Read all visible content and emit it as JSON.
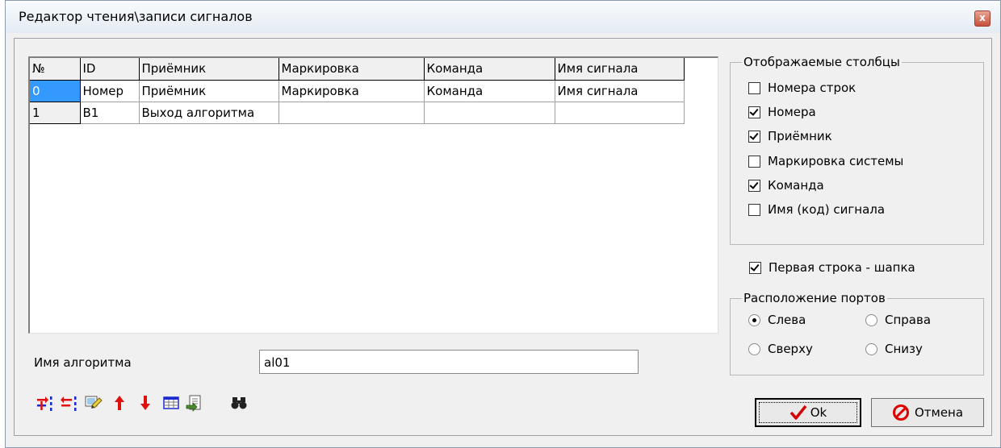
{
  "window": {
    "title": "Редактор чтения\\записи сигналов",
    "close_label": "x"
  },
  "grid": {
    "headers": [
      "№",
      "ID",
      "Приёмник",
      "Маркировка",
      "Команда",
      "Имя сигнала"
    ],
    "rows": [
      [
        "0",
        "Номер",
        "Приёмник",
        "Маркировка",
        "Команда",
        "Имя сигнала"
      ],
      [
        "1",
        "B1",
        "Выход алгоритма",
        "",
        "",
        ""
      ]
    ]
  },
  "columns_group": {
    "title": "Отображаемые столбцы",
    "items": [
      {
        "label": "Номера строк",
        "checked": false
      },
      {
        "label": "Номера",
        "checked": true
      },
      {
        "label": "Приёмник",
        "checked": true
      },
      {
        "label": "Маркировка системы",
        "checked": false
      },
      {
        "label": "Команда",
        "checked": true
      },
      {
        "label": "Имя (код) сигнала",
        "checked": false
      }
    ]
  },
  "header_row": {
    "label": "Первая строка - шапка",
    "checked": true
  },
  "ports_group": {
    "title": "Расположение портов",
    "options": [
      {
        "label": "Слева",
        "checked": true
      },
      {
        "label": "Справа",
        "checked": false
      },
      {
        "label": "Сверху",
        "checked": false
      },
      {
        "label": "Снизу",
        "checked": false
      }
    ]
  },
  "algorithm": {
    "label": "Имя алгоритма",
    "value": "al01"
  },
  "toolbar": [
    "add-row-icon",
    "delete-row-icon",
    "edit-icon",
    "move-up-icon",
    "move-down-icon",
    "table-icon",
    "import-icon",
    "find-icon"
  ],
  "buttons": {
    "ok": "Ok",
    "cancel": "Отмена"
  },
  "colors": {
    "selection": "#3399ff",
    "ok_check": "#d90000",
    "cancel_icon": "#e00000",
    "toolbar_red": "#e01010",
    "toolbar_blue": "#1a2ad0"
  }
}
